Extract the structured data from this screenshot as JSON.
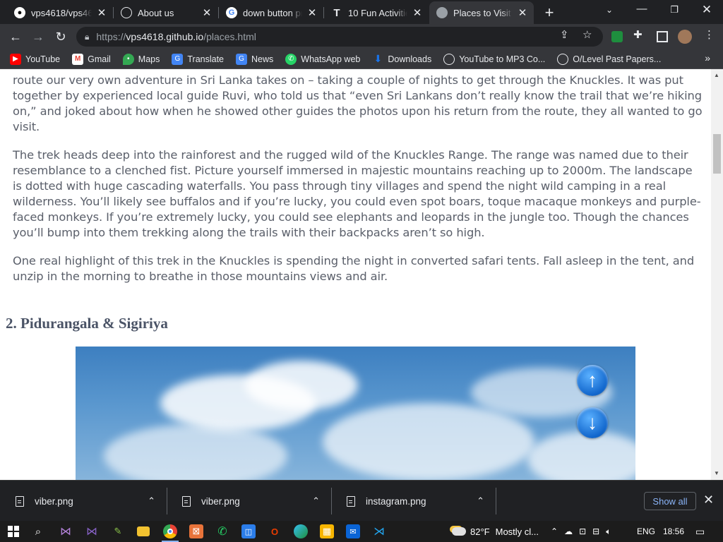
{
  "browser": {
    "tabs": [
      {
        "title": "vps4618/vps461",
        "favicon": "github-icon",
        "active": false
      },
      {
        "title": "About us",
        "favicon": "globe-icon",
        "active": false
      },
      {
        "title": "down button pr",
        "favicon": "google-icon",
        "active": false
      },
      {
        "title": "10 Fun Activitie",
        "favicon": "t-icon",
        "active": false
      },
      {
        "title": "Places to Visit fo",
        "favicon": "globe-icon",
        "active": true
      }
    ],
    "url_scheme": "https://",
    "url_host": "vps4618.github.io",
    "url_path": "/places.html",
    "bookmarks": [
      {
        "label": "YouTube",
        "icon": "youtube-icon",
        "color": "#ff0000"
      },
      {
        "label": "Gmail",
        "icon": "gmail-icon",
        "color": "#ea4335"
      },
      {
        "label": "Maps",
        "icon": "maps-icon",
        "color": "#34a853"
      },
      {
        "label": "Translate",
        "icon": "translate-icon",
        "color": "#4285f4"
      },
      {
        "label": "News",
        "icon": "news-icon",
        "color": "#4285f4"
      },
      {
        "label": "WhatsApp web",
        "icon": "whatsapp-icon",
        "color": "#25d366"
      },
      {
        "label": "Downloads",
        "icon": "download-icon",
        "color": "#1a73e8"
      },
      {
        "label": "YouTube to MP3 Co...",
        "icon": "globe-icon",
        "color": "#5f6368"
      },
      {
        "label": "O/Level Past Papers...",
        "icon": "globe-icon",
        "color": "#5f6368"
      }
    ]
  },
  "article": {
    "paragraphs": [
      "route our very own adventure in Sri Lanka takes on – taking a couple of nights to get through the Knuckles. It was put together by experienced local guide Ruvi, who told us that “even Sri Lankans don’t really know the trail that we’re hiking on,” and joked about how when he showed other guides the photos upon his return from the route, they all wanted to go visit.",
      "The trek heads deep into the rainforest and the rugged wild of the Knuckles Range. The range was named due to their resemblance to a clenched fist. Picture yourself immersed in majestic mountains reaching up to 2000m. The landscape is dotted with huge cascading waterfalls. You pass through tiny villages and spend the night wild camping in a real wilderness. You’ll likely see buffalos and if you’re lucky, you could even spot boars, toque macaque monkeys and purple-faced monkeys. If you’re extremely lucky, you could see elephants and leopards in the jungle too. Though the chances you’ll bump into them trekking along the trails with their backpacks aren’t so high.",
      "One real highlight of this trek in the Knuckles is spending the night in converted safari tents. Fall asleep in the tent, and unzip in the morning to breathe in those mountains views and air."
    ],
    "section_heading": "2. Pidurangala & Sigiriya"
  },
  "downloads": {
    "items": [
      {
        "name": "viber.png"
      },
      {
        "name": "viber.png"
      },
      {
        "name": "instagram.png"
      }
    ],
    "show_all": "Show all"
  },
  "taskbar": {
    "temperature": "82°F",
    "weather": "Mostly cl...",
    "language": "ENG",
    "time": "18:56"
  }
}
